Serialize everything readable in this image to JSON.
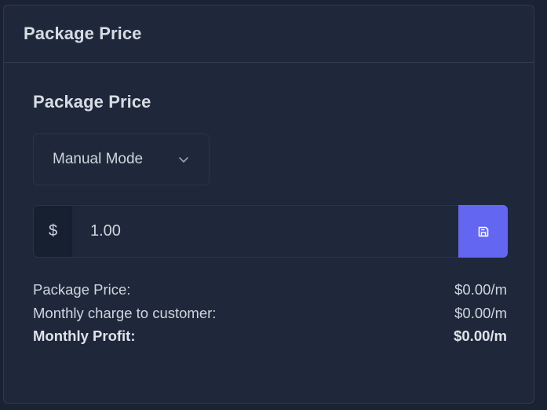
{
  "card": {
    "header_title": "Package Price"
  },
  "section": {
    "title": "Package Price"
  },
  "mode_select": {
    "selected": "Manual Mode"
  },
  "price_input": {
    "prefix": "$",
    "value": "1.00"
  },
  "save_button": {
    "icon": "save-icon",
    "color": "#6366f1"
  },
  "summary": {
    "rows": [
      {
        "label": "Package Price:",
        "value": "$0.00/m"
      },
      {
        "label": "Monthly charge to customer:",
        "value": "$0.00/m"
      },
      {
        "label": "Monthly Profit:",
        "value": "$0.00/m"
      }
    ]
  }
}
